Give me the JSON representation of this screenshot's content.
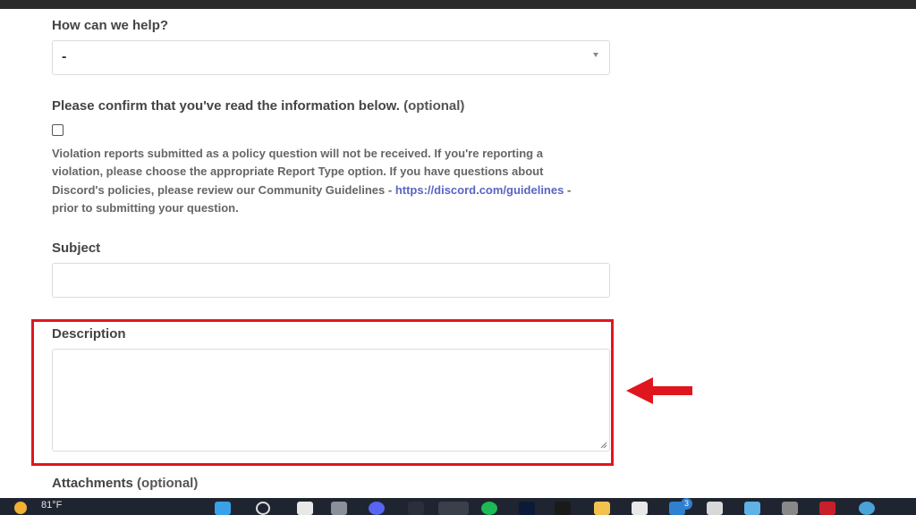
{
  "form": {
    "help_label": "How can we help?",
    "help_select_value": "-",
    "confirm_label": "Please confirm that you've read the information below.",
    "confirm_optional": "(optional)",
    "info_text_part1": "Violation reports submitted as a policy question will not be received. If you're reporting a violation, please choose the appropriate Report Type option. If you have questions about Discord's policies, please review our Community Guidelines - ",
    "info_link": "https://discord.com/guidelines",
    "info_text_part2": " - prior to submitting your question.",
    "subject_label": "Subject",
    "description_label": "Description",
    "attachments_label": "Attachments",
    "attachments_optional": "(optional)"
  },
  "taskbar": {
    "temperature": "81°F",
    "mail_badge_count": "3"
  },
  "annotation": {
    "highlight_color": "#e0161f"
  }
}
